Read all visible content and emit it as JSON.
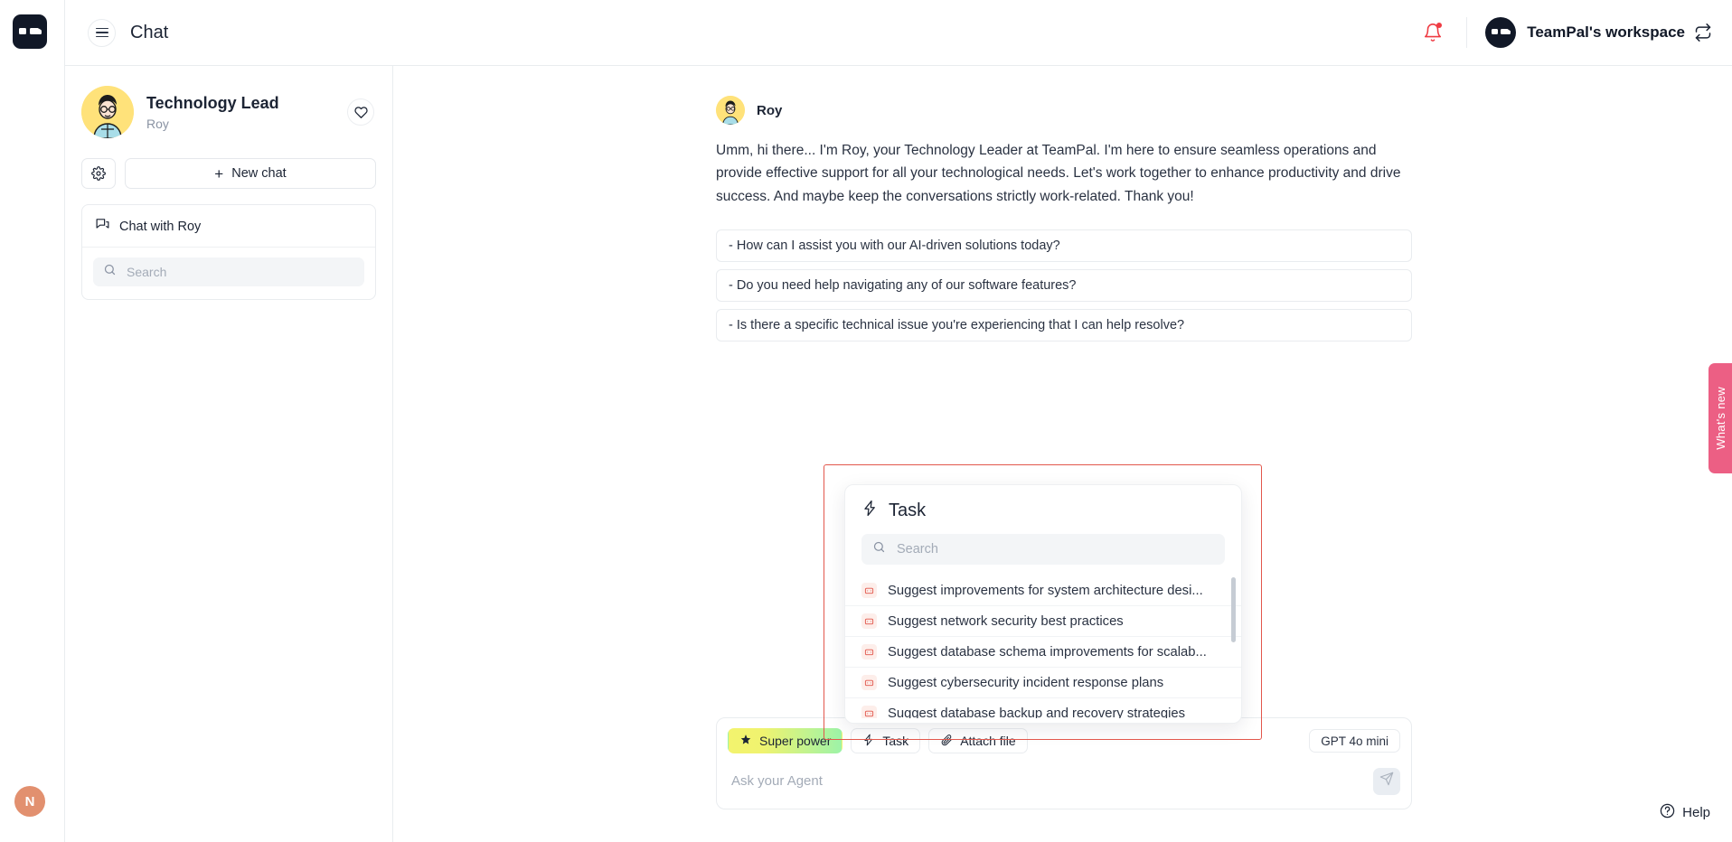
{
  "header": {
    "title": "Chat",
    "menu_icon": "hamburger-icon",
    "logo_icon": "teampal-logo-icon",
    "bell_icon": "notification-bell-icon",
    "workspace_name": "TeamPal's workspace",
    "swap_icon": "swap-workspace-icon"
  },
  "sidebar": {
    "agent_role": "Technology Lead",
    "agent_name": "Roy",
    "favorite_icon": "heart-icon",
    "settings_icon": "gear-icon",
    "new_chat_label": "New chat",
    "new_chat_plus": "+",
    "chat_item_label": "Chat with Roy",
    "chat_item_icon": "chat-bubbles-icon",
    "search_placeholder": "Search",
    "search_value": "",
    "search_icon": "search-icon"
  },
  "conversation": {
    "author": "Roy",
    "avatar_icon": "agent-avatar-roy",
    "message": "Umm, hi there... I'm Roy, your Technology Leader at TeamPal. I'm here to ensure seamless operations and provide effective support for all your technological needs. Let's work together to enhance productivity and drive success. And maybe keep the conversations strictly work-related. Thank you!",
    "suggestions": [
      "- How can I assist you with our AI-driven solutions today?",
      "- Do you need help navigating any of our software features?",
      "- Is there a specific technical issue you're experiencing that I can help resolve?"
    ]
  },
  "task_popup": {
    "title": "Task",
    "title_icon": "lightning-bolt-icon",
    "search_placeholder": "Search",
    "search_value": "",
    "search_icon": "search-icon",
    "items": [
      "Suggest improvements for system architecture desi...",
      "Suggest network security best practices",
      "Suggest database schema improvements for scalab...",
      "Suggest cybersecurity incident response plans",
      "Suggest database backup and recovery strategies"
    ],
    "item_icon": "robot-icon",
    "highlight_color": "#e2574c"
  },
  "composer": {
    "super_power_label": "Super power",
    "super_power_icon": "star-icon",
    "task_label": "Task",
    "task_icon": "lightning-bolt-icon",
    "attach_label": "Attach file",
    "attach_icon": "paperclip-icon",
    "model_label": "GPT 4o mini",
    "input_placeholder": "Ask your Agent",
    "input_value": "",
    "send_icon": "send-paper-plane-icon"
  },
  "right_widgets": {
    "whats_new_label": "What's new",
    "help_label": "Help",
    "help_icon": "question-circle-icon"
  },
  "user": {
    "avatar_initial": "N",
    "avatar_color": "#e2906f"
  }
}
